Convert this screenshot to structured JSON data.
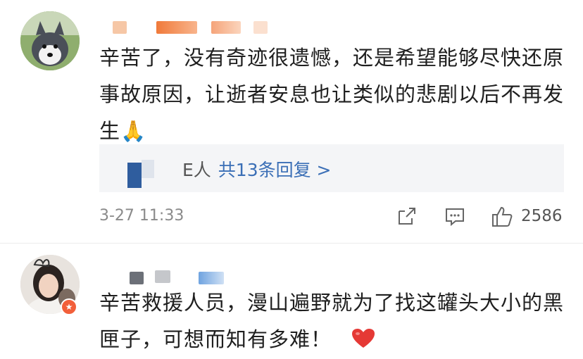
{
  "comments": [
    {
      "text": "辛苦了，没有奇迹很遗憾，还是希望能够尽快还原事故原因，让逝者安息也让类似的悲剧以后不再发生🙏",
      "reply_prefix": "",
      "reply_partial": "E人",
      "reply_link": "共13条回复 >",
      "time": "3-27 11:33",
      "like_count": "2586"
    },
    {
      "text": "辛苦救援人员，漫山遍野就为了找这罐头大小的黑匣子，可想而知有多难！",
      "heart_icon": "heart-icon"
    }
  ],
  "icons": {
    "share": "share-icon",
    "comment": "comment-icon",
    "like": "thumbs-up-icon"
  },
  "colors": {
    "link": "#3b6fb6",
    "badge": "#f25f3a",
    "heart": "#e53935"
  }
}
